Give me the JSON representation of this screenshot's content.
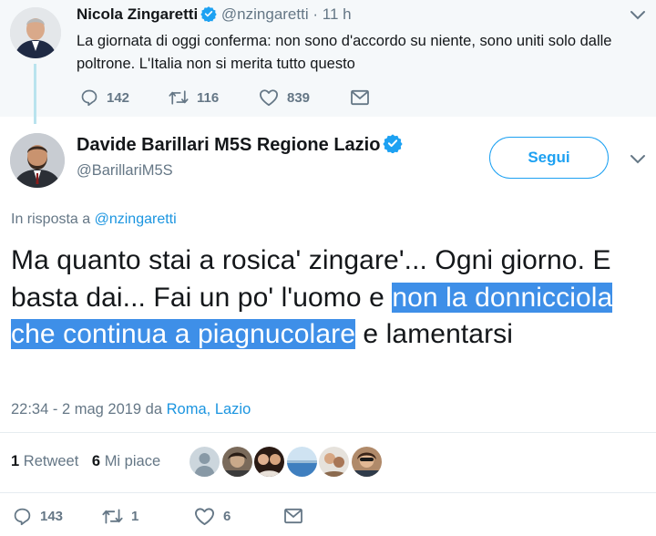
{
  "parent_tweet": {
    "name": "Nicola Zingaretti",
    "handle": "@nzingaretti",
    "separator": "·",
    "time": "11 h",
    "text": "La giornata di oggi conferma: non sono d'accordo su niente, sono uniti solo dalle poltrone. L'Italia non si merita tutto questo",
    "replies": "142",
    "retweets": "116",
    "likes": "839"
  },
  "main_tweet": {
    "name": "Davide Barillari M5S Regione Lazio",
    "handle": "@BarillariM5S",
    "follow_label": "Segui",
    "reply_prefix": "In risposta a",
    "reply_to": "@nzingaretti",
    "text_before": "Ma quanto stai a rosica' zingare'... Ogni giorno. E basta dai... Fai un po' l'uomo e ",
    "text_highlight": "non la donnicciola che continua a piagnucolare",
    "text_after": " e lamentarsi",
    "timestamp": "22:34 - 2 mag 2019 da",
    "location": "Roma, Lazio",
    "retweet_count": "1",
    "retweet_label": "Retweet",
    "like_count": "6",
    "like_label": "Mi piace",
    "replies": "143",
    "retweets": "1",
    "likes": "6"
  },
  "colors": {
    "accent": "#1da1f2",
    "link": "#1b95e0",
    "secondary_text": "#657786",
    "highlight": "#3e8fe8",
    "parent_bg": "#f5f8fa"
  },
  "icons": [
    "verified-badge-icon",
    "chevron-down-icon",
    "reply-icon",
    "retweet-icon",
    "heart-icon",
    "mail-icon"
  ]
}
